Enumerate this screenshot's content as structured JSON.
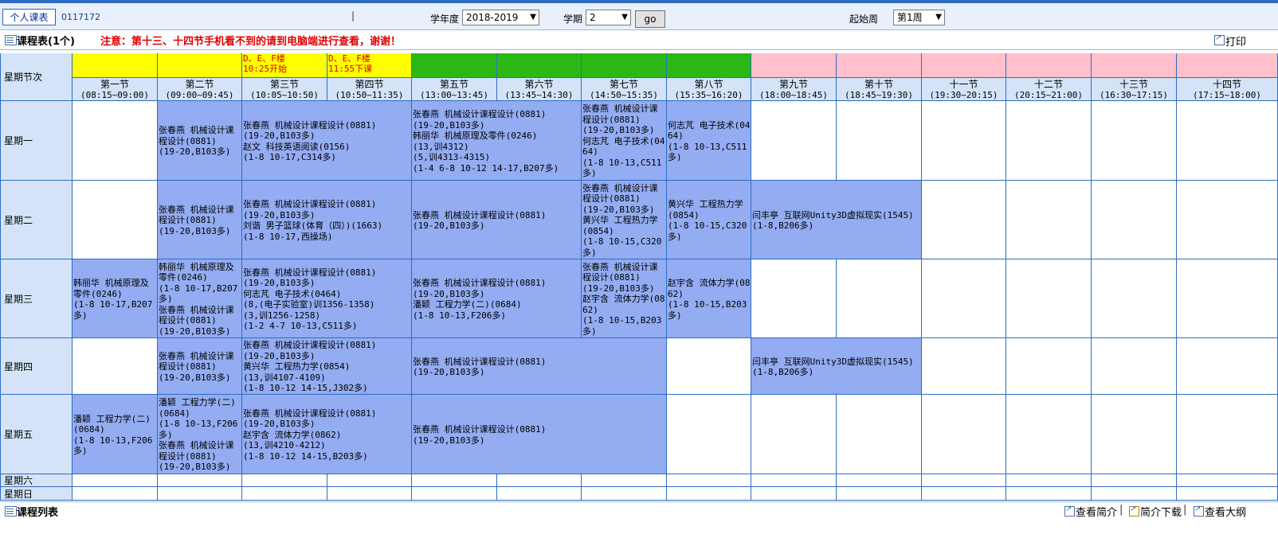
{
  "topbar": {
    "personal_tab": "个人课表",
    "student_id": "0117172",
    "separator": "|",
    "year_label": "学年度",
    "year_value": "2018-2019",
    "term_label": "学期",
    "term_value": "2",
    "go_label": "go",
    "start_week_label": "起始周",
    "start_week_value": "第1周"
  },
  "section": {
    "title": "课程表(1个)",
    "notice": "注意：第十三、十四节手机看不到的请到电脑端进行查看，谢谢！",
    "print_label": "打印"
  },
  "grid": {
    "corner_label": "星期节次",
    "band_notes": [
      "",
      "",
      "D、E、F楼\n10:25开始",
      "D、E、F楼\n11:55下课",
      "",
      "",
      "",
      "",
      "",
      "",
      "",
      "",
      "",
      ""
    ],
    "band_colors": [
      "#ffff00",
      "#ffff00",
      "#ffff00",
      "#ffff00",
      "#2cb814",
      "#2cb814",
      "#2cb814",
      "#2cb814",
      "#ffc0cb",
      "#ffc0cb",
      "#ffc0cb",
      "#ffc0cb",
      "#ffc0cb",
      "#ffc0cb"
    ],
    "slots": [
      {
        "name": "第一节",
        "time": "(08:15~09:00)"
      },
      {
        "name": "第二节",
        "time": "(09:00~09:45)"
      },
      {
        "name": "第三节",
        "time": "(10:05~10:50)"
      },
      {
        "name": "第四节",
        "time": "(10:50~11:35)"
      },
      {
        "name": "第五节",
        "time": "(13:00~13:45)"
      },
      {
        "name": "第六节",
        "time": "(13:45~14:30)"
      },
      {
        "name": "第七节",
        "time": "(14:50~15:35)"
      },
      {
        "name": "第八节",
        "time": "(15:35~16:20)"
      },
      {
        "name": "第九节",
        "time": "(18:00~18:45)"
      },
      {
        "name": "第十节",
        "time": "(18:45~19:30)"
      },
      {
        "name": "十一节",
        "time": "(19:30~20:15)"
      },
      {
        "name": "十二节",
        "time": "(20:15~21:00)"
      },
      {
        "name": "十三节",
        "time": "(16:30~17:15)"
      },
      {
        "name": "十四节",
        "time": "(17:15~18:00)"
      }
    ],
    "days": [
      "星期一",
      "星期二",
      "星期三",
      "星期四",
      "星期五",
      "星期六",
      "星期日"
    ],
    "courses": [
      {
        "day": 0,
        "start": 1,
        "span": 1,
        "text": "张春燕 机械设计课程设计(0881)\n(19-20,B103多)"
      },
      {
        "day": 0,
        "start": 2,
        "span": 2,
        "text": "张春燕 机械设计课程设计(0881)\n(19-20,B103多)\n赵文 科技英语阅读(0156)\n(1-8 10-17,C314多)"
      },
      {
        "day": 0,
        "start": 4,
        "span": 2,
        "text": "张春燕 机械设计课程设计(0881)\n(19-20,B103多)\n韩丽华 机械原理及零件(0246)\n(13,训4312)\n(5,训4313-4315)\n(1-4 6-8 10-12 14-17,B207多)"
      },
      {
        "day": 0,
        "start": 6,
        "span": 1,
        "text": "张春燕 机械设计课程设计(0881)\n(19-20,B103多)\n何志芃 电子技术(0464)\n(1-8 10-13,C511多)"
      },
      {
        "day": 0,
        "start": 7,
        "span": 1,
        "text": "何志芃 电子技术(0464)\n(1-8 10-13,C511多)"
      },
      {
        "day": 1,
        "start": 1,
        "span": 1,
        "text": "张春燕 机械设计课程设计(0881)\n(19-20,B103多)"
      },
      {
        "day": 1,
        "start": 2,
        "span": 2,
        "text": "张春燕 机械设计课程设计(0881)\n(19-20,B103多)\n刘谐 男子篮球(体育（四）)(1663)\n(1-8 10-17,西操场)"
      },
      {
        "day": 1,
        "start": 4,
        "span": 2,
        "text": "张春燕 机械设计课程设计(0881)\n(19-20,B103多)"
      },
      {
        "day": 1,
        "start": 6,
        "span": 1,
        "text": "张春燕 机械设计课程设计(0881)\n(19-20,B103多)\n黄兴华 工程热力学(0854)\n(1-8 10-15,C320多)"
      },
      {
        "day": 1,
        "start": 7,
        "span": 1,
        "text": "黄兴华 工程热力学(0854)\n(1-8 10-15,C320多)"
      },
      {
        "day": 1,
        "start": 8,
        "span": 2,
        "text": "闫丰亭 互联网Unity3D虚拟现实(1545)\n(1-8,B206多)"
      },
      {
        "day": 2,
        "start": 0,
        "span": 1,
        "text": "韩丽华 机械原理及零件(0246)\n(1-8 10-17,B207多)"
      },
      {
        "day": 2,
        "start": 1,
        "span": 1,
        "text": "韩丽华 机械原理及零件(0246)\n(1-8 10-17,B207多)\n张春燕 机械设计课程设计(0881)\n(19-20,B103多)"
      },
      {
        "day": 2,
        "start": 2,
        "span": 2,
        "text": "张春燕 机械设计课程设计(0881)\n(19-20,B103多)\n何志芃 电子技术(0464)\n(8,(电子实验室)训1356-1358)\n(3,训1256-1258)\n(1-2 4-7 10-13,C511多)"
      },
      {
        "day": 2,
        "start": 4,
        "span": 2,
        "text": "张春燕 机械设计课程设计(0881)\n(19-20,B103多)\n潘颖 工程力学(二)(0684)\n(1-8 10-13,F206多)"
      },
      {
        "day": 2,
        "start": 6,
        "span": 1,
        "text": "张春燕 机械设计课程设计(0881)\n(19-20,B103多)\n赵宇含 流体力学(0862)\n(1-8 10-15,B203多)"
      },
      {
        "day": 2,
        "start": 7,
        "span": 1,
        "text": "赵宇含 流体力学(0862)\n(1-8 10-15,B203多)"
      },
      {
        "day": 3,
        "start": 1,
        "span": 1,
        "text": "张春燕 机械设计课程设计(0881)\n(19-20,B103多)"
      },
      {
        "day": 3,
        "start": 2,
        "span": 2,
        "text": "张春燕 机械设计课程设计(0881)\n(19-20,B103多)\n黄兴华 工程热力学(0854)\n(13,训4107-4109)\n(1-8 10-12 14-15,J302多)"
      },
      {
        "day": 3,
        "start": 4,
        "span": 3,
        "text": "张春燕 机械设计课程设计(0881)\n(19-20,B103多)"
      },
      {
        "day": 3,
        "start": 8,
        "span": 2,
        "text": "闫丰亭 互联网Unity3D虚拟现实(1545)\n(1-8,B206多)"
      },
      {
        "day": 4,
        "start": 0,
        "span": 1,
        "text": "潘颖 工程力学(二)(0684)\n(1-8 10-13,F206多)"
      },
      {
        "day": 4,
        "start": 1,
        "span": 1,
        "text": "潘颖 工程力学(二)(0684)\n(1-8 10-13,F206多)\n张春燕 机械设计课程设计(0881)\n(19-20,B103多)"
      },
      {
        "day": 4,
        "start": 2,
        "span": 2,
        "text": "张春燕 机械设计课程设计(0881)\n(19-20,B103多)\n赵宇含 流体力学(0862)\n(13,训4210-4212)\n(1-8 10-12 14-15,B203多)"
      },
      {
        "day": 4,
        "start": 4,
        "span": 3,
        "text": "张春燕 机械设计课程设计(0881)\n(19-20,B103多)"
      }
    ]
  },
  "footer": {
    "title": "课程列表",
    "links": [
      "查看简介",
      "简介下载",
      "查看大纲"
    ],
    "separator": "|"
  }
}
